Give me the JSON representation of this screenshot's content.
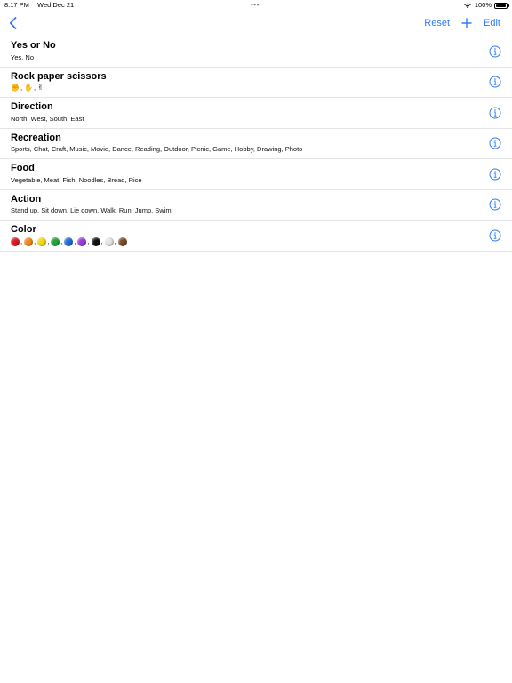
{
  "status_bar": {
    "time": "8:17 PM",
    "date": "Wed Dec 21",
    "dots": "•••",
    "battery_text": "100%",
    "battery_level": 1.0,
    "icons": [
      "wifi-icon",
      "battery-icon"
    ]
  },
  "nav": {
    "back_icon": "chevron-left-icon",
    "reset_label": "Reset",
    "add_icon": "plus-icon",
    "edit_label": "Edit",
    "accent_color": "#2F7BF6"
  },
  "lists": [
    {
      "title": "Yes or No",
      "subtitle": "Yes, No"
    },
    {
      "title": "Rock paper scissors",
      "emoji": [
        "✊",
        "✋",
        "✌"
      ]
    },
    {
      "title": "Direction",
      "subtitle": "North, West, South, East"
    },
    {
      "title": "Recreation",
      "subtitle": "Sports, Chat, Craft, Music, Movie, Dance, Reading, Outdoor, Picnic, Game, Hobby, Drawing, Photo"
    },
    {
      "title": "Food",
      "subtitle": "Vegetable, Meat, Fish, Noodles, Bread, Rice"
    },
    {
      "title": "Action",
      "subtitle": "Stand up, Sit down, Lie down, Walk, Run, Jump, Swim"
    },
    {
      "title": "Color",
      "colors": [
        "#D91A22",
        "#F08A1C",
        "#F7D712",
        "#22A43A",
        "#1C6ED6",
        "#9B3AD9",
        "#111111",
        "#E6E6E6",
        "#7A4A2A"
      ]
    }
  ]
}
